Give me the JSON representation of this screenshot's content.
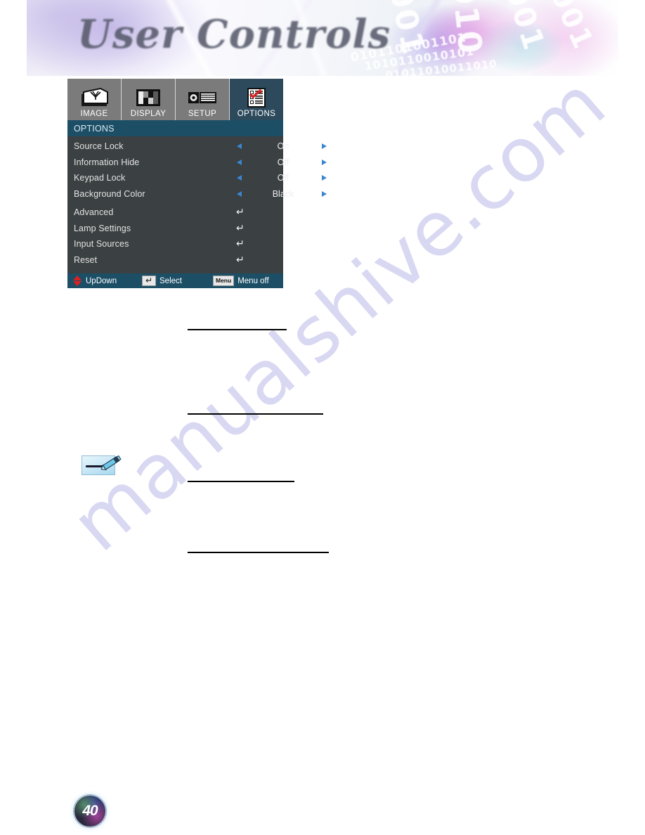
{
  "banner": {
    "title": "User Controls",
    "binary_motifs": [
      "1001",
      "0010",
      "1001",
      "1001",
      "0101101001101",
      "1010110010101",
      "01011010011010"
    ]
  },
  "osd": {
    "tabs": [
      {
        "label": "IMAGE",
        "icon": "image-tab-icon",
        "active": false
      },
      {
        "label": "DISPLAY",
        "icon": "display-tab-icon",
        "active": false
      },
      {
        "label": "SETUP",
        "icon": "setup-tab-icon",
        "active": false
      },
      {
        "label": "OPTIONS",
        "icon": "options-tab-icon",
        "active": true
      }
    ],
    "header_title": "OPTIONS",
    "value_rows": [
      {
        "label": "Source Lock",
        "value": "On"
      },
      {
        "label": "Information Hide",
        "value": "Off"
      },
      {
        "label": "Keypad Lock",
        "value": "Off"
      },
      {
        "label": "Background Color",
        "value": "Black"
      }
    ],
    "submenu_rows": [
      {
        "label": "Advanced",
        "enter": "↵"
      },
      {
        "label": "Lamp Settings",
        "enter": "↵"
      },
      {
        "label": "Input Sources",
        "enter": "↵"
      },
      {
        "label": "Reset",
        "enter": "↵"
      }
    ],
    "footer": {
      "updown_label": "UpDown",
      "select_key": "↵",
      "select_label": "Select",
      "menu_key": "Menu",
      "menu_label": "Menu off"
    },
    "colors": {
      "header_bar": "#1c4f66",
      "body": "#3b4042",
      "tab_inactive": "#7b7b7b",
      "tab_active": "#2d4a5c",
      "arrow_blue": "#3b86d0",
      "updown_red": "#e01f1f"
    }
  },
  "page": {
    "number": "40",
    "watermark": "manualshive.com"
  }
}
